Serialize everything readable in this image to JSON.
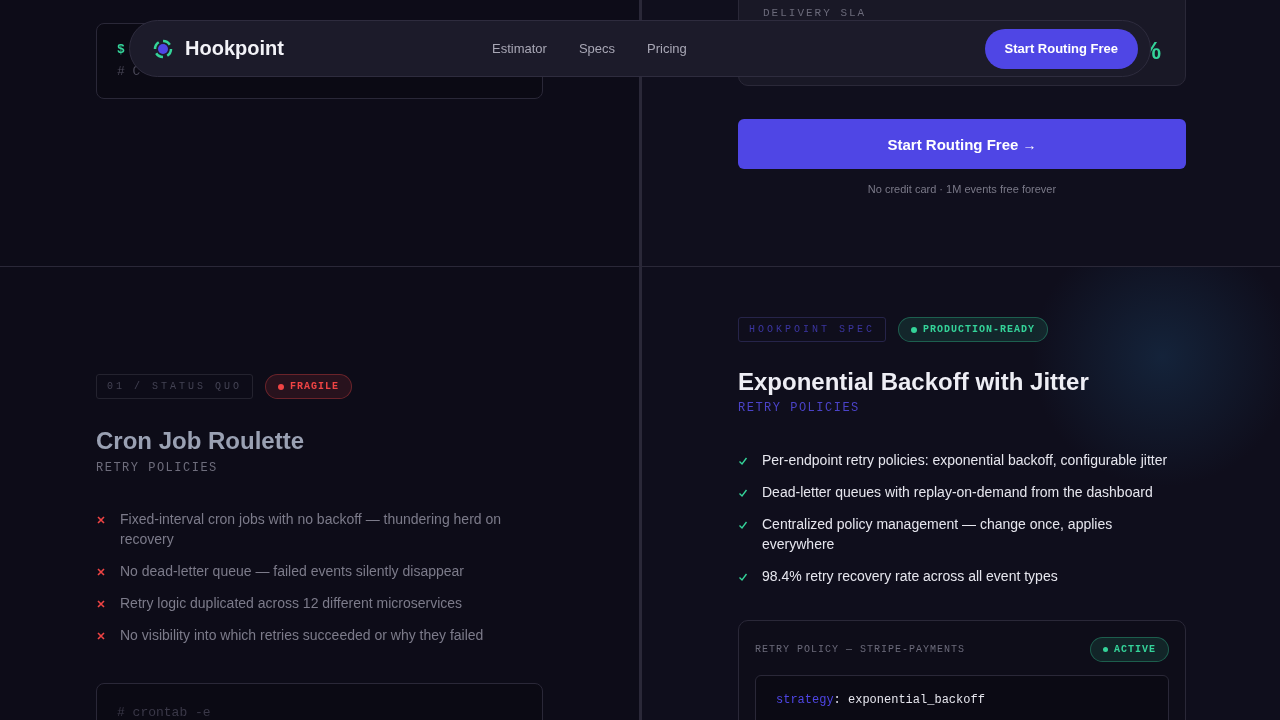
{
  "nav": {
    "brand": "Hookpoint",
    "links": [
      "Estimator",
      "Specs",
      "Pricing"
    ],
    "cta": "Start Routing Free"
  },
  "top_left": {
    "code_lines": [
      {
        "kind": "prompt",
        "text": "$"
      },
      {
        "kind": "comment",
        "text": "# C"
      }
    ]
  },
  "top_right": {
    "sla_label": "DELIVERY SLA",
    "sla_value": "%",
    "cta": "Start Routing Free",
    "cta_arrow": "→",
    "note": "No credit card · 1M events free forever"
  },
  "status_quo": {
    "tag": "01 / STATUS QUO",
    "badge": {
      "text": "FRAGILE",
      "color": "#ef4444"
    },
    "title": "Cron Job Roulette",
    "subtitle": "RETRY POLICIES",
    "items": [
      {
        "kind": "cross",
        "text": "Fixed-interval cron jobs with no backoff — thundering herd on recovery"
      },
      {
        "kind": "cross",
        "text": "No dead-letter queue — failed events silently disappear"
      },
      {
        "kind": "cross",
        "text": "Retry logic duplicated across 12 different microservices"
      },
      {
        "kind": "cross",
        "text": "No visibility into which retries succeeded or why they failed"
      }
    ],
    "code_lines": [
      "# crontab -e"
    ]
  },
  "spec": {
    "tag": "HOOKPOINT SPEC",
    "badge": {
      "text": "PRODUCTION-READY",
      "color": "#34d399"
    },
    "title": "Exponential Backoff with Jitter",
    "subtitle": "RETRY POLICIES",
    "items": [
      {
        "kind": "check",
        "text": "Per-endpoint retry policies: exponential backoff, configurable jitter"
      },
      {
        "kind": "check",
        "text": "Dead-letter queues with replay-on-demand from the dashboard"
      },
      {
        "kind": "check",
        "text": "Centralized policy management — change once, applies everywhere"
      },
      {
        "kind": "check",
        "text": "98.4% retry recovery rate across all event types"
      }
    ],
    "policy": {
      "title": "RETRY POLICY — STRIPE-PAYMENTS",
      "status": {
        "text": "ACTIVE",
        "color": "#34d399"
      },
      "lines": [
        {
          "key": "strategy",
          "sep": ":",
          "value": "exponential_backoff"
        }
      ]
    }
  }
}
